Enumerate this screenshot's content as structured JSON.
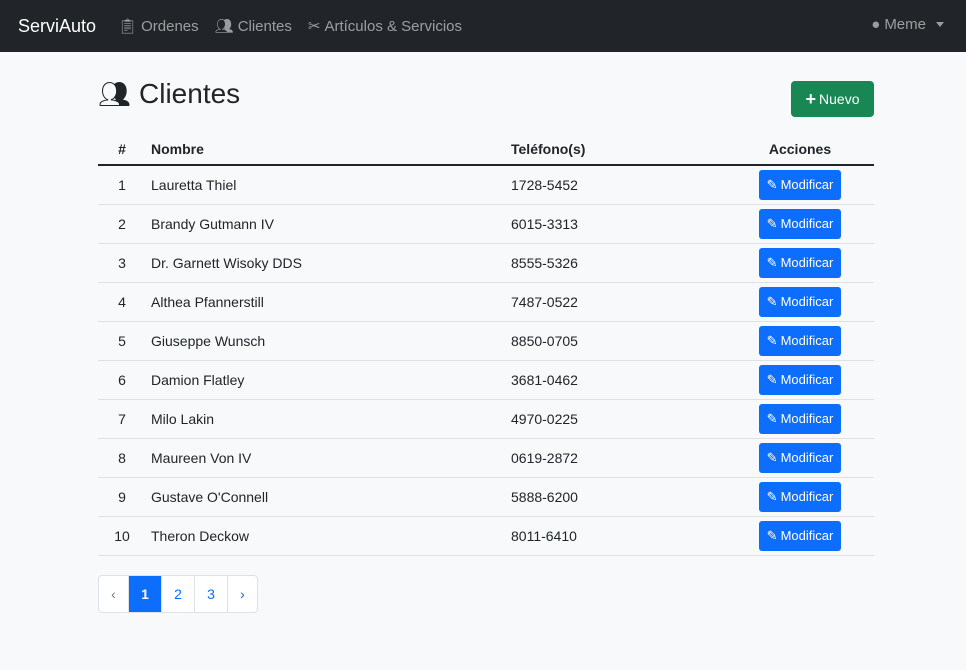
{
  "navbar": {
    "brand": "ServiAuto",
    "links": [
      {
        "label": "Ordenes",
        "icon": "clipboard-icon"
      },
      {
        "label": "Clientes",
        "icon": "users-icon"
      },
      {
        "label": "Artículos & Servicios",
        "icon": "tools-icon"
      }
    ],
    "user": "Meme"
  },
  "page": {
    "title": "Clientes",
    "new_button": "Nuevo"
  },
  "table": {
    "headers": [
      "#",
      "Nombre",
      "Teléfono(s)",
      "Acciones"
    ],
    "action_label": "Modificar",
    "rows": [
      {
        "n": "1",
        "name": "Lauretta Thiel",
        "phone": "1728-5452"
      },
      {
        "n": "2",
        "name": "Brandy Gutmann IV",
        "phone": "6015-3313"
      },
      {
        "n": "3",
        "name": "Dr. Garnett Wisoky DDS",
        "phone": "8555-5326"
      },
      {
        "n": "4",
        "name": "Althea Pfannerstill",
        "phone": "7487-0522"
      },
      {
        "n": "5",
        "name": "Giuseppe Wunsch",
        "phone": "8850-0705"
      },
      {
        "n": "6",
        "name": "Damion Flatley",
        "phone": "3681-0462"
      },
      {
        "n": "7",
        "name": "Milo Lakin",
        "phone": "4970-0225"
      },
      {
        "n": "8",
        "name": "Maureen Von IV",
        "phone": "0619-2872"
      },
      {
        "n": "9",
        "name": "Gustave O'Connell",
        "phone": "5888-6200"
      },
      {
        "n": "10",
        "name": "Theron Deckow",
        "phone": "8011-6410"
      }
    ]
  },
  "pagination": {
    "prev": "‹",
    "pages": [
      "1",
      "2",
      "3"
    ],
    "current": "1",
    "next": "›"
  },
  "colors": {
    "navbar": "#212529",
    "primary": "#0d6efd",
    "success": "#198754"
  }
}
